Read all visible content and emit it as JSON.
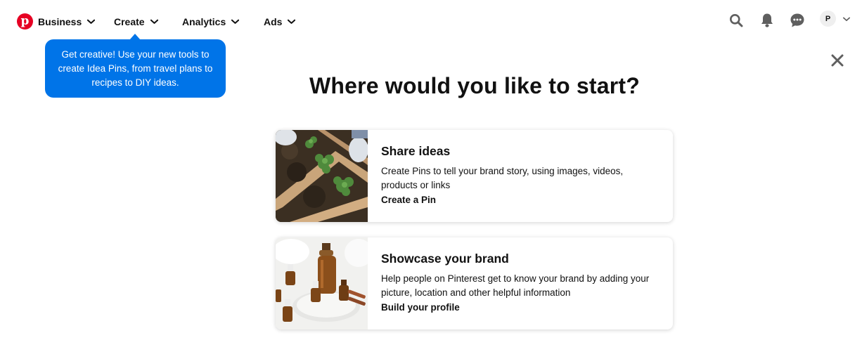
{
  "nav": {
    "items": [
      {
        "label": "Business"
      },
      {
        "label": "Create"
      },
      {
        "label": "Analytics"
      },
      {
        "label": "Ads"
      }
    ],
    "avatar_initial": "P"
  },
  "icons": {
    "logo": "pinterest-logo-icon",
    "search": "search-icon",
    "notifications": "bell-icon",
    "messages": "chat-bubble-icon",
    "close": "close-icon"
  },
  "colors": {
    "brand_red": "#e60023",
    "tooltip_blue": "#0074e8"
  },
  "tooltip": {
    "text": "Get creative! Use your new tools to create Idea Pins, from travel plans to recipes to DIY ideas."
  },
  "main": {
    "heading": "Where would you like to start?",
    "cards": [
      {
        "title": "Share ideas",
        "description": "Create Pins to tell your brand story, using images, videos, products or links",
        "link": "Create a Pin"
      },
      {
        "title": "Showcase your brand",
        "description": "Help people on Pinterest get to know your brand by adding your picture, location and other helpful information",
        "link": "Build your profile"
      }
    ]
  }
}
